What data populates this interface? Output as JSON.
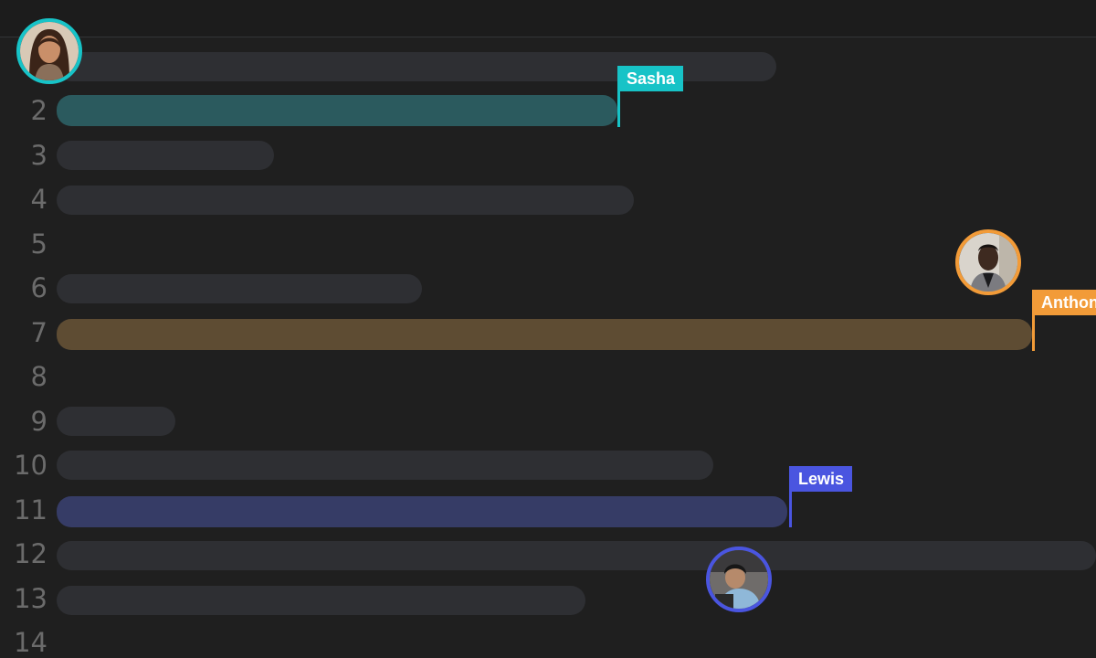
{
  "gutter": {
    "line_numbers": [
      "2",
      "3",
      "4",
      "5",
      "6",
      "7",
      "8",
      "9",
      "10",
      "11",
      "12",
      "13",
      "14"
    ]
  },
  "collaborators": {
    "sasha": {
      "name": "Sasha",
      "color": "#17c3c7",
      "selection_color": "#2b5a5e"
    },
    "anthony": {
      "name": "Anthon",
      "color": "#f29b38",
      "selection_color": "#5e4c33"
    },
    "lewis": {
      "name": "Lewis",
      "color": "#4a55e0",
      "selection_color": "#363c66"
    }
  },
  "icons": {
    "sasha_avatar": "person-avatar-icon",
    "anthony_avatar": "person-avatar-icon",
    "lewis_avatar": "person-avatar-icon"
  }
}
